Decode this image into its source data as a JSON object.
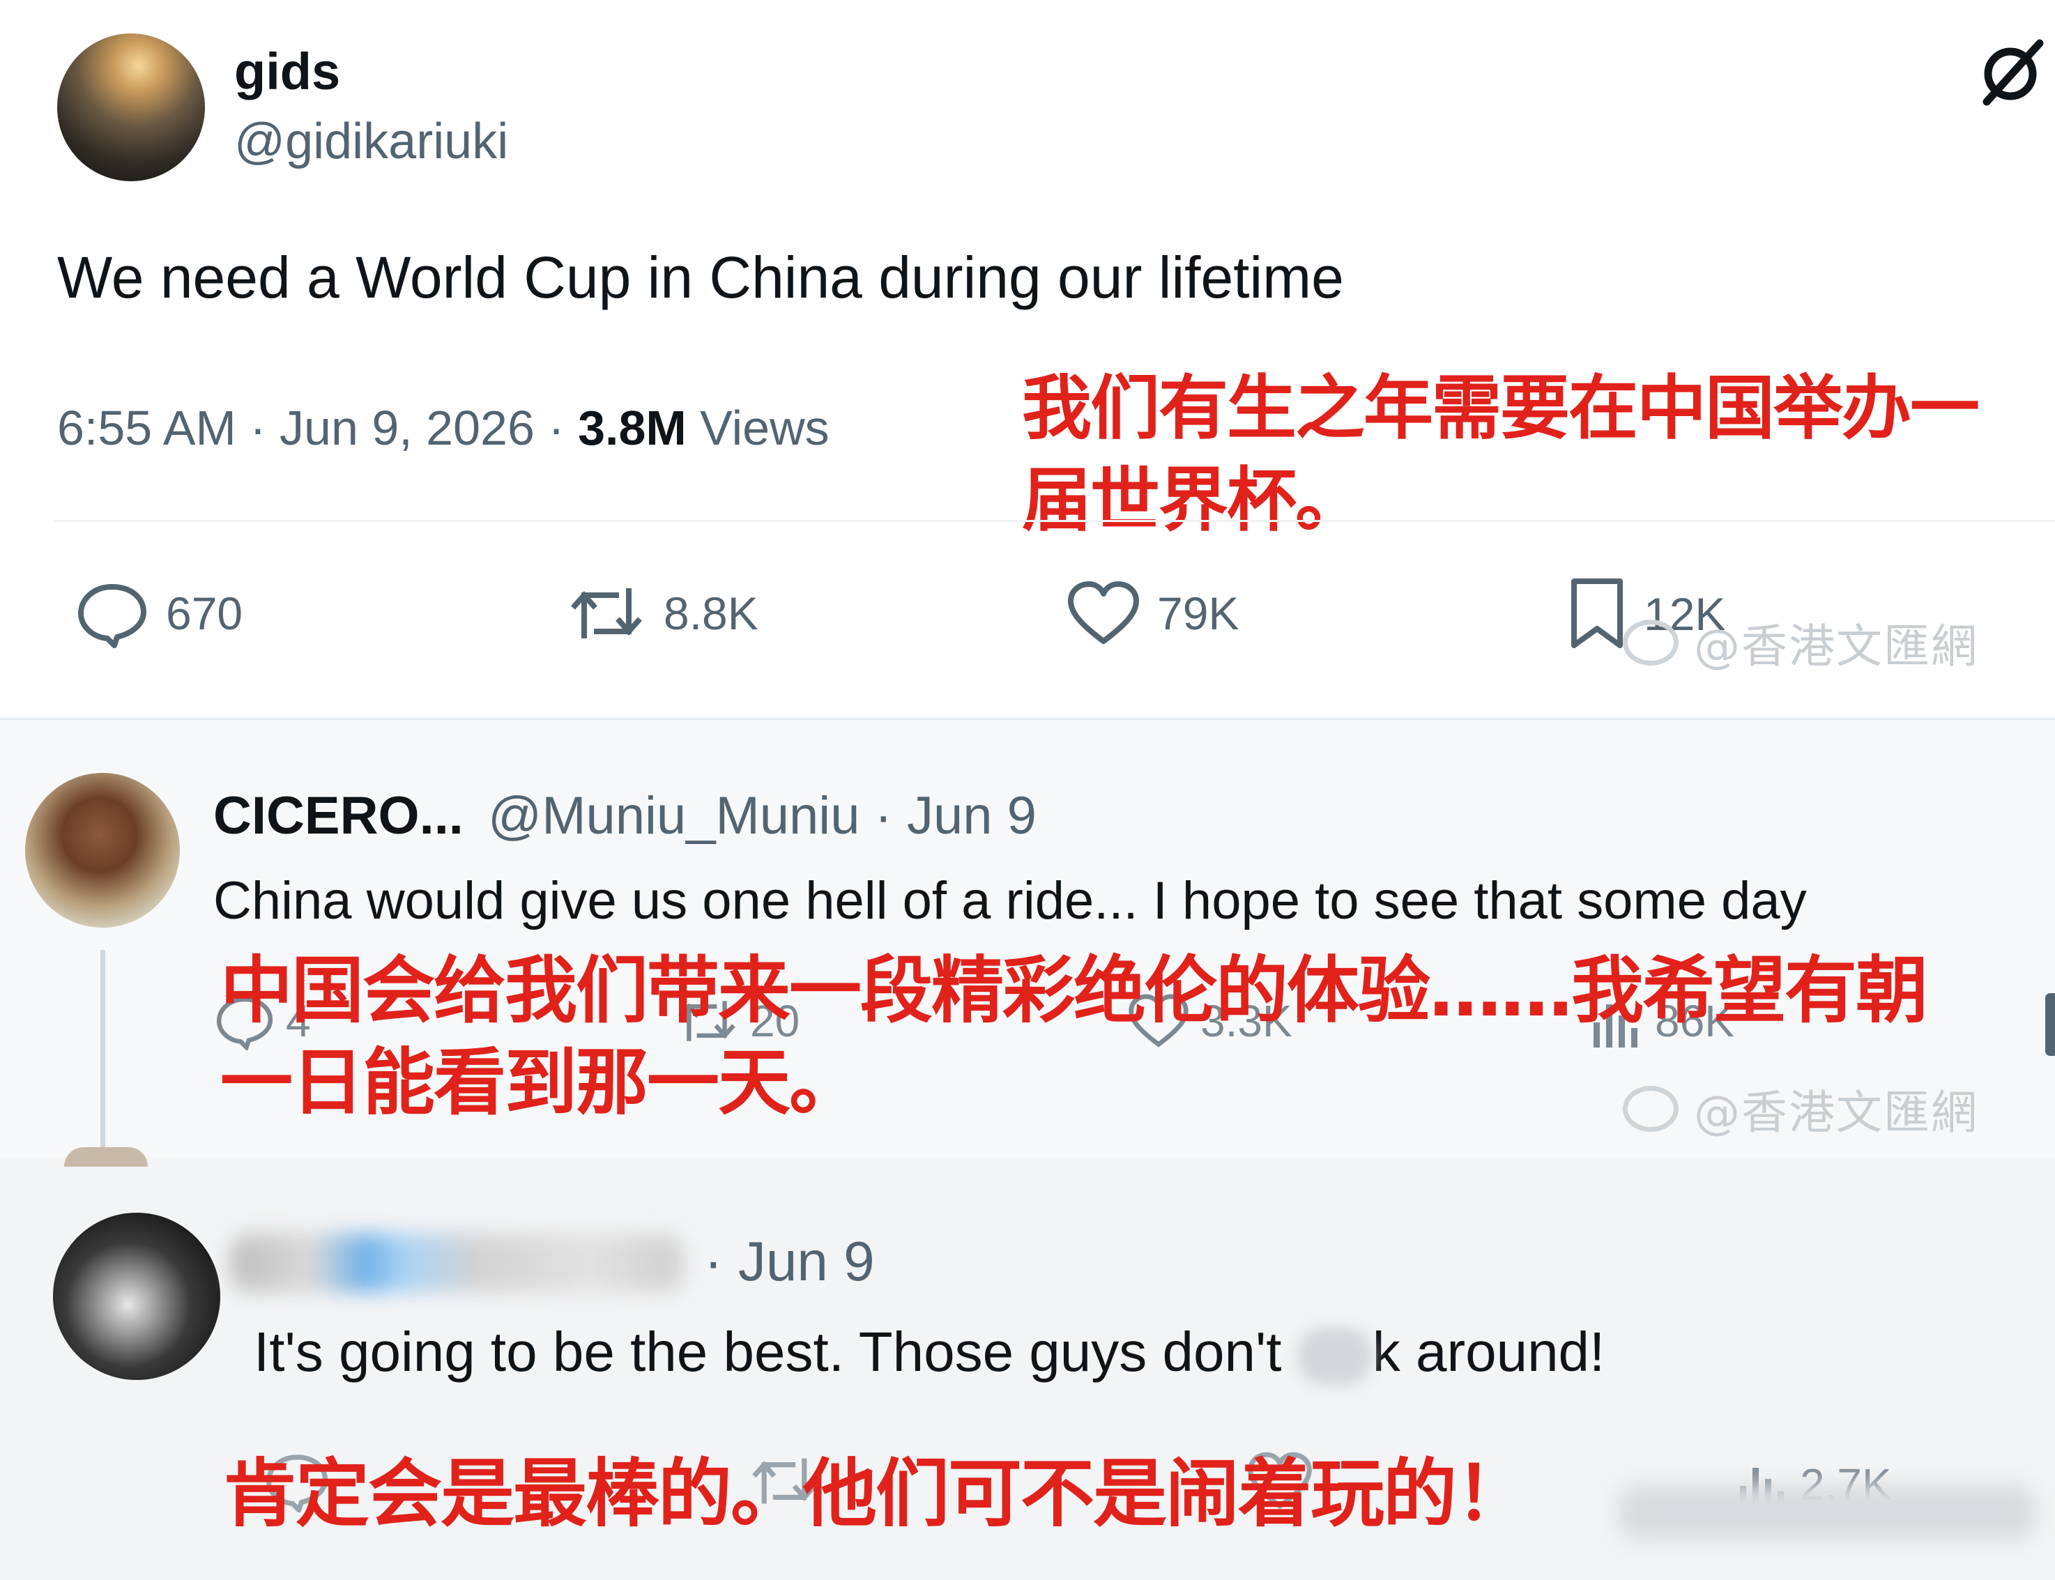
{
  "tweet": {
    "display_name": "gids",
    "handle": "@gidikariuki",
    "text": "We need a World Cup in China during our lifetime",
    "time_date": "6:55 AM · Jun 9, 2026 · ",
    "views_count": "3.8M",
    "views_label": " Views",
    "translation_line1": "我们有生之年需要在中国举办一",
    "translation_line2": "届世界杯。",
    "stats": {
      "replies": "670",
      "retweets": "8.8K",
      "likes": "79K",
      "bookmarks": "12K"
    }
  },
  "watermark": {
    "text": "@香港文匯網"
  },
  "reply1": {
    "display_name": "CICERO...",
    "handle_date": "@Muniu_Muniu · Jun 9",
    "text": "China would give us one hell of a ride... I hope to see that some day",
    "translation_line1": "中国会给我们带来一段精彩绝伦的体验……我希望有朝",
    "translation_line2": "一日能看到那一天。",
    "stats": {
      "replies": "4",
      "retweets": "20",
      "likes": "3.3K",
      "views": "86K"
    }
  },
  "reply2": {
    "date": "· Jun 9",
    "text_part1": "It's going to be the best. Those guys don't ",
    "text_part2": "k around!",
    "translation": "肯定会是最棒的。他们可不是闹着玩的！",
    "stats": {
      "views": "2.7K"
    }
  },
  "colors": {
    "accent_red": "#e0221b",
    "muted": "#536471",
    "text": "#0f1419",
    "divider": "#eff3f4"
  }
}
